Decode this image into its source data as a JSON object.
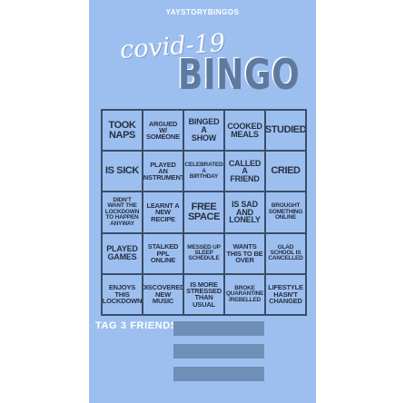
{
  "handle": "YAYSTORYBINGOS",
  "title_script": "covid-19",
  "title_main": "BINGO",
  "colors": {
    "card_background": "#9dbff0",
    "title": "#5f7a9f",
    "grid_lines": "#3c4d66",
    "cell_text": "#27303f",
    "tag_lines": "#6f8fb6"
  },
  "grid": {
    "rows": [
      [
        "TOOK\nNAPS",
        "ARGUED\nW/\nSOMEONE",
        "BINGED\nA\nSHOW",
        "COOKED\nMEALS",
        "STUDIED"
      ],
      [
        "IS SICK",
        "PLAYED\nAN\nINSTRUMENT",
        "CELEBRATED\nA\nBIRTHDAY",
        "CALLED\nA\nFRIEND",
        "CRIED"
      ],
      [
        "DIDN'T\nWANT THE\nLOCKDOWN\nTO HAPPEN\nANYWAY",
        "LEARNT A\nNEW\nRECIPE",
        "FREE\nSPACE",
        "IS SAD\nAND\nLONELY",
        "BROUGHT\nSOMETHING\nONLINE"
      ],
      [
        "PLAYED\nGAMES",
        "STALKED\nPPL\nONLINE",
        "MESSED UP\nSLEEP\nSCHEDULE",
        "WANTS\nTHIS TO BE\nOVER",
        "GLAD\nSCHOOL IS\nCANCELLED"
      ],
      [
        "ENJOYS\nTHIS\nLOCKDOWN",
        "DISCOVERED\nNEW\nMUSIC",
        "IS MORE\nSTRESSED\nTHAN USUAL",
        "BROKE\nQUARANTINE\n/REBELLED",
        "LIFESTYLE\nHASN'T\nCHANGED"
      ]
    ]
  },
  "tag": {
    "label": "TAG 3 FRIENDS",
    "blank_lines": 3
  }
}
